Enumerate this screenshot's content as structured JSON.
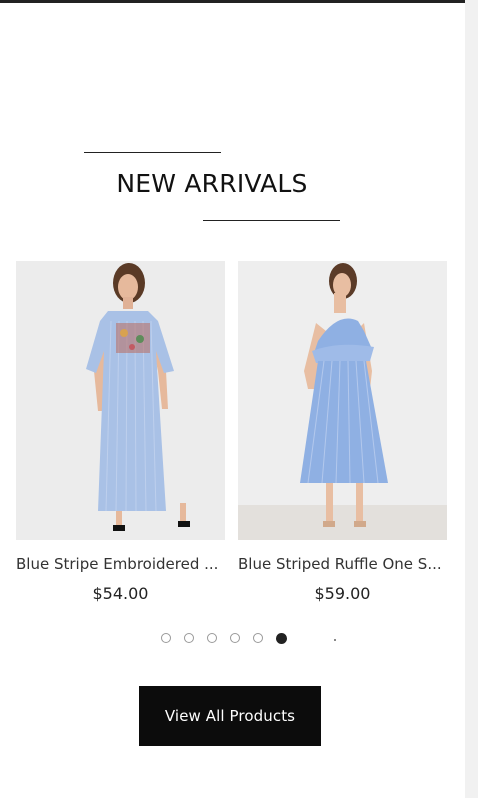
{
  "section": {
    "title": "NEW ARRIVALS"
  },
  "products": [
    {
      "name": "Blue Stripe Embroidered ...",
      "price": "$54.00",
      "image_icon": "product-photo-dress-embroidered"
    },
    {
      "name": "Blue Striped Ruffle One S...",
      "price": "$59.00",
      "image_icon": "product-photo-dress-ruffle"
    }
  ],
  "carousel": {
    "dot_count": 6,
    "active_index": 5
  },
  "cta": {
    "label": "View All Products"
  },
  "colors": {
    "accent": "#0c0c0c",
    "dress_blue": "#a9c1e6",
    "dress_blue_2": "#8fb0e3"
  }
}
